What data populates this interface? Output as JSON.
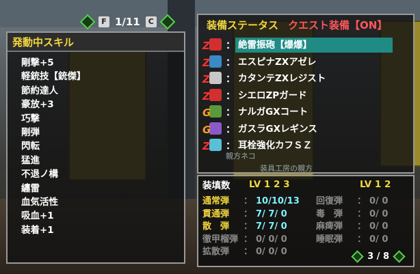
{
  "pager": {
    "key_left": "F",
    "page": "1/11",
    "key_right": "C"
  },
  "skills": {
    "title": "発動中スキル",
    "items": [
      "剛撃+5",
      "軽銃技【銃傑】",
      "節約達人",
      "豪放+3",
      "巧撃",
      "剛弾",
      "閃転",
      "猛進",
      "不退ノ構",
      "纏雷",
      "血気活性",
      "吸血+1",
      "装着+1"
    ]
  },
  "equipment": {
    "title": "装備ステータス",
    "quest_label": "クエスト装備【ON】",
    "items": [
      {
        "badge": "Z",
        "color": "#ff3030",
        "name": "絶雷振砲【爆爆】",
        "selected": true
      },
      {
        "badge": "Z",
        "color": "#ff3030",
        "name": "エスピナZXアゼレ",
        "selected": false
      },
      {
        "badge": "Z",
        "color": "#ff3030",
        "name": "カタンテZXレジスト",
        "selected": false
      },
      {
        "badge": "Z",
        "color": "#ff3030",
        "name": "シエロZPガード",
        "selected": false
      },
      {
        "badge": "G",
        "color": "#ff9d22",
        "name": "ナルガGXコート",
        "selected": false
      },
      {
        "badge": "G",
        "color": "#ff9d22",
        "name": "ガスラGXレギンス",
        "selected": false
      },
      {
        "badge": "Z",
        "color": "#ff3030",
        "name": "耳栓強化カフＳＺ",
        "selected": false
      }
    ],
    "behind_text": [
      "親方ネコ",
      "装具工房の親方"
    ]
  },
  "ammo": {
    "title": "装填数",
    "lv_left": "LV 1  2  3",
    "lv_right": "LV 1  2",
    "rows": [
      {
        "name": "通常弾",
        "val": "10/10/13",
        "name2": "回復弾",
        "val2": "0/ 0",
        "on": true
      },
      {
        "name": "貫通弾",
        "val": " 7/ 7/ 0",
        "name2": "毒　弾",
        "val2": "0/ 0",
        "on": true
      },
      {
        "name": "散　弾",
        "val": " 7/ 7/ 0",
        "name2": "麻痺弾",
        "val2": "0/ 0",
        "on": true
      },
      {
        "name": "徹甲榴弾",
        "val": " 0/ 0/ 0",
        "name2": "睡眠弾",
        "val2": "0/ 0",
        "on": false
      },
      {
        "name": "拡散弾",
        "val": " 0/ 0/ 0",
        "name2": "",
        "val2": "",
        "on": false
      }
    ],
    "page": "3 / 8"
  },
  "colors": {
    "accent_yellow": "#f4d83e",
    "accent_red": "#ff5757",
    "select_teal": "#1f8b84",
    "value_cyan": "#7ef3ff"
  }
}
